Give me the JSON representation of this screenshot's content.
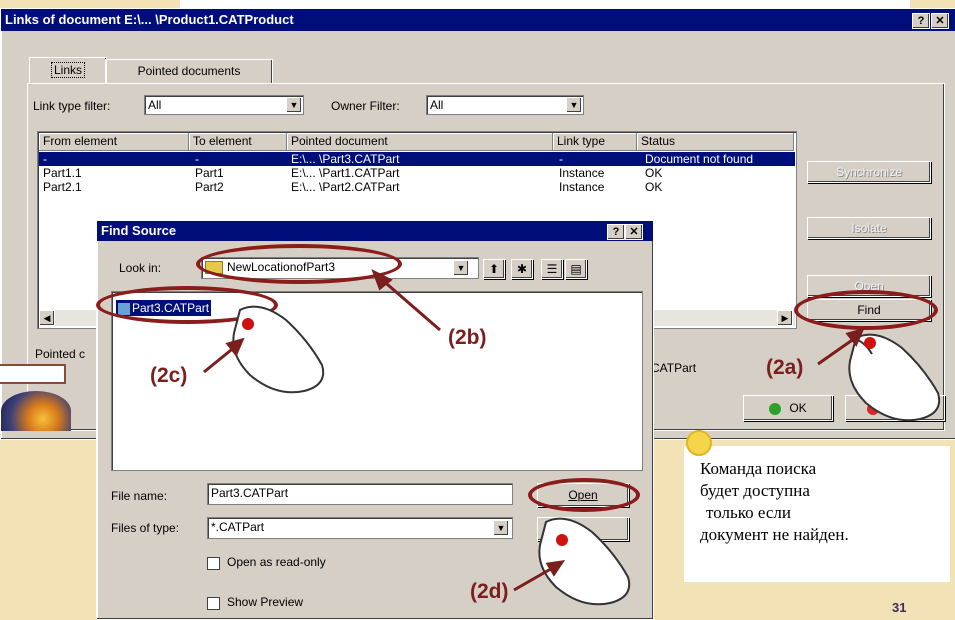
{
  "main_dialog": {
    "title": "Links of document E:\\... \\Product1.CATProduct",
    "tabs": [
      "Links",
      "Pointed documents"
    ],
    "link_filter_label": "Link type filter:",
    "link_filter_value": "All",
    "owner_filter_label": "Owner Filter:",
    "owner_filter_value": "All",
    "columns": [
      "From element",
      "To element",
      "Pointed document",
      "Link type",
      "Status"
    ],
    "rows": [
      {
        "from": "-",
        "to": "-",
        "doc": "E:\\... \\Part3.CATPart",
        "type": "-",
        "status": "Document not found"
      },
      {
        "from": "Part1.1",
        "to": "Part1",
        "doc": "E:\\... \\Part1.CATPart",
        "type": "Instance",
        "status": "OK"
      },
      {
        "from": "Part2.1",
        "to": "Part2",
        "doc": "E:\\... \\Part2.CATPart",
        "type": "Instance",
        "status": "OK"
      }
    ],
    "buttons": {
      "synchronize": "Synchronize",
      "isolate": "Isolate",
      "open": "Open",
      "find": "Find"
    },
    "pointed_label": "Pointed c",
    "pointed_value": "CATPart",
    "ok": "OK",
    "cancel": "Cancel"
  },
  "find_dialog": {
    "title": "Find Source",
    "look_in_label": "Look in:",
    "look_in_value": "NewLocationofPart3",
    "file_item": "Part3.CATPart",
    "file_name_label": "File name:",
    "file_name_value": "Part3.CATPart",
    "files_type_label": "Files of type:",
    "files_type_value": "*.CATPart",
    "open_button": "Open",
    "readonly_label": "Open as read-only",
    "preview_label": "Show Preview"
  },
  "annotations": {
    "a": "(2a)",
    "b": "(2b)",
    "c": "(2c)",
    "d": "(2d)"
  },
  "note": [
    "Команда поиска",
    "будет доступна",
    "только если",
    "документ не найден."
  ],
  "page_number": "31",
  "colors": {
    "accent": "#7a1e1e",
    "titlebar": "#000e7b",
    "dialog": "#d6cfc6",
    "background": "#f4e2b7"
  }
}
